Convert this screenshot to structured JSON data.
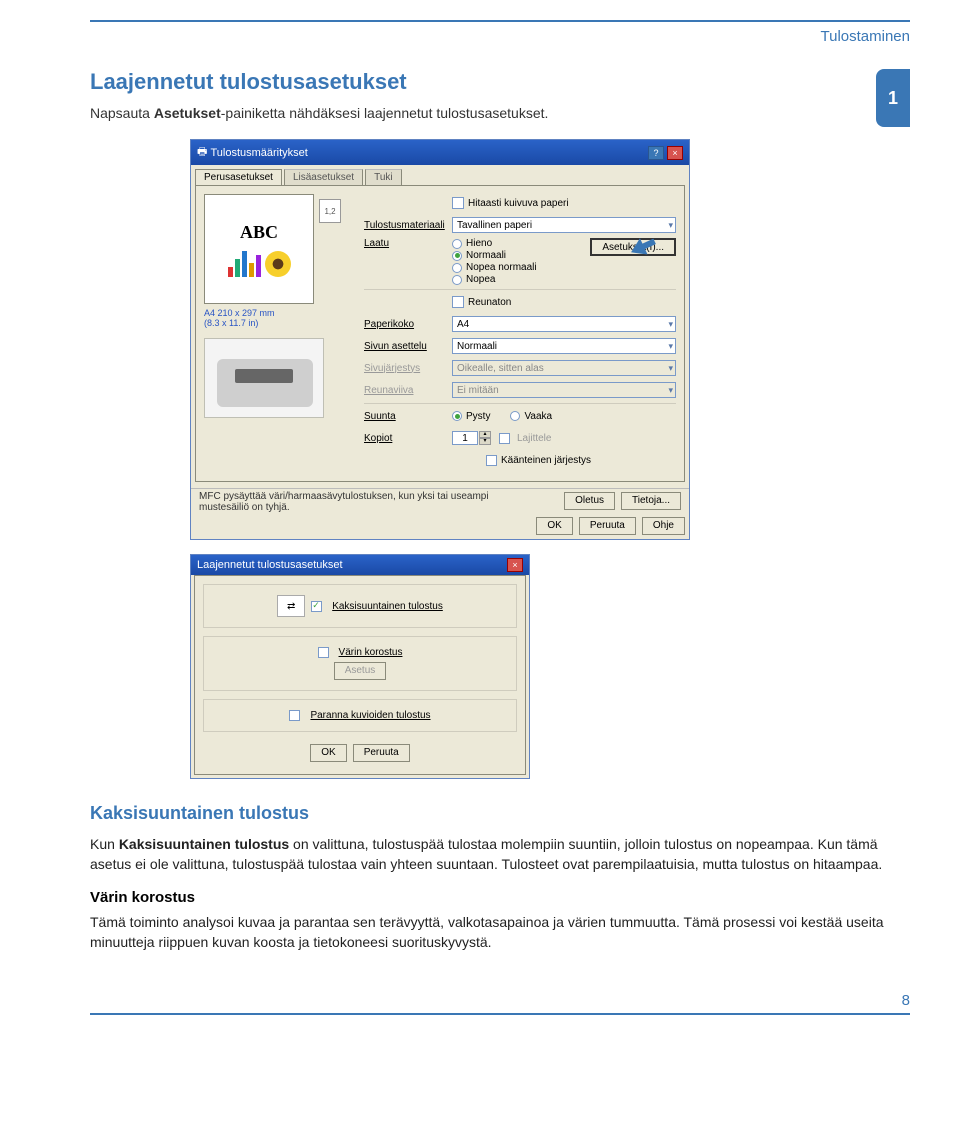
{
  "header": {
    "section": "Tulostaminen",
    "chapter_num": "1"
  },
  "title": "Laajennetut tulostusasetukset",
  "intro": {
    "pre": "Napsauta ",
    "bold": "Asetukset",
    "post": "-painiketta nähdäksesi laajennetut tulostusasetukset."
  },
  "dlg1": {
    "title": "Tulostusmääritykset",
    "tabs": [
      "Perusasetukset",
      "Lisäasetukset",
      "Tuki"
    ],
    "preview": {
      "abc": "ABC",
      "paper_spec_1": "A4 210 x 297 mm",
      "paper_spec_2": "(8.3 x 11.7 in)",
      "tray_badge": "1,2"
    },
    "checks": {
      "slow_dry": "Hitaasti kuivuva paperi",
      "borderless": "Reunaton",
      "collate": "Lajittele",
      "reverse": "Käänteinen järjestys"
    },
    "labels": {
      "media": "Tulostusmateriaali",
      "quality": "Laatu",
      "paper_size": "Paperikoko",
      "layout": "Sivun asettelu",
      "order": "Sivujärjestys",
      "borderline": "Reunaviiva",
      "orientation": "Suunta",
      "copies": "Kopiot"
    },
    "selects": {
      "media": "Tavallinen paperi",
      "paper_size": "A4",
      "layout": "Normaali",
      "order": "Oikealle, sitten alas",
      "borderline": "Ei mitään"
    },
    "quality_opts": [
      "Hieno",
      "Normaali",
      "Nopea normaali",
      "Nopea"
    ],
    "quality_selected": "Normaali",
    "orient_opts": [
      "Pysty",
      "Vaaka"
    ],
    "orient_selected": "Pysty",
    "copies": "1",
    "settings_btn": "Asetukset(I)...",
    "info_note": "MFC pysäyttää väri/harmaasävytulostuksen, kun yksi tai useampi mustesäiliö on tyhjä.",
    "buttons": {
      "defaults": "Oletus",
      "info": "Tietoja...",
      "ok": "OK",
      "cancel": "Peruuta",
      "help": "Ohje"
    }
  },
  "dlg2": {
    "title": "Laajennetut tulostusasetukset",
    "bidi": "Kaksisuuntainen tulostus",
    "color": "Värin korostus",
    "setbtn": "Asetus",
    "pattern": "Paranna kuvioiden tulostus",
    "ok": "OK",
    "cancel": "Peruuta"
  },
  "body": {
    "h2": "Kaksisuuntainen tulostus",
    "p1_a": "Kun ",
    "p1_b": "Kaksisuuntainen tulostus",
    "p1_c": " on valittuna, tulostuspää tulostaa molempiin suuntiin, jolloin tulostus on nopeampaa. Kun tämä asetus ei ole valittuna, tulostuspää tulostaa vain yhteen suuntaan. Tulosteet ovat parempilaatuisia, mutta tulostus on hitaampaa.",
    "h3": "Värin korostus",
    "p2": " Tämä toiminto analysoi kuvaa ja parantaa sen terävyyttä, valkotasapainoa ja värien tummuutta. Tämä prosessi voi kestää useita minuutteja riippuen kuvan koosta ja tietokoneesi suorituskyvystä."
  },
  "pagenum": "8"
}
